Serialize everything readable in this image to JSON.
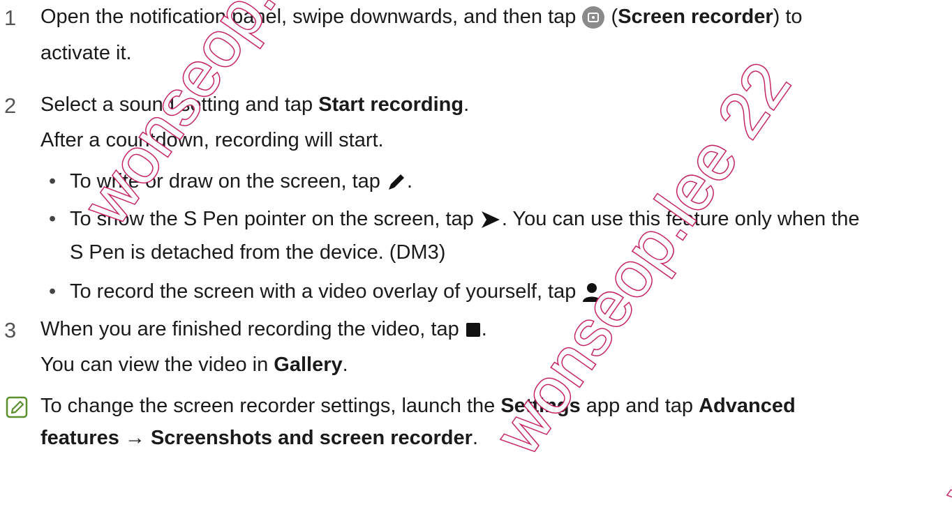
{
  "steps": [
    {
      "number": "1",
      "line1_pre": "Open the notification panel, swipe downwards, and then tap",
      "line1_mid": " (",
      "line1_bold": "Screen recorder",
      "line1_post": ") to",
      "line2": "activate it.",
      "icon": "screen-recorder-icon"
    },
    {
      "number": "2",
      "line1_pre": "Select a sound setting and tap ",
      "line1_bold": "Start recording",
      "line1_post": ".",
      "line2": "After a countdown, recording will start."
    },
    {
      "number": "3",
      "line1_pre": "When you are finished recording the video, tap",
      "line1_post": ".",
      "line2_pre": "You can view the video in ",
      "line2_bold": "Gallery",
      "line2_post": ".",
      "icon": "stop-icon"
    }
  ],
  "bullets": [
    {
      "pre": "To write or draw on the screen, tap",
      "post": ".",
      "icon": "pen-icon"
    },
    {
      "pre": "To show the S Pen pointer on the screen, tap",
      "post": ". You can use this feature only when the",
      "line2": "S Pen is detached from the device. (DM3)",
      "icon": "pointer-icon"
    },
    {
      "pre": "To record the screen with a video overlay of yourself, tap",
      "post": ".",
      "icon": "person-icon"
    }
  ],
  "bullet_symbol": "•",
  "note": {
    "icon": "note-icon",
    "line1_pre": "To change the screen recorder settings, launch the ",
    "line1_bold1": "Settings",
    "line1_mid": " app and tap ",
    "line1_bold2": "Advanced",
    "line2_bold1": "features",
    "line2_arrow": " → ",
    "line2_bold2": "Screenshots and screen recorder",
    "line2_post": "."
  },
  "watermark": "wonseop.lee 22",
  "colors": {
    "watermark": "#c2185b",
    "note_icon": "#5a8f2c"
  }
}
